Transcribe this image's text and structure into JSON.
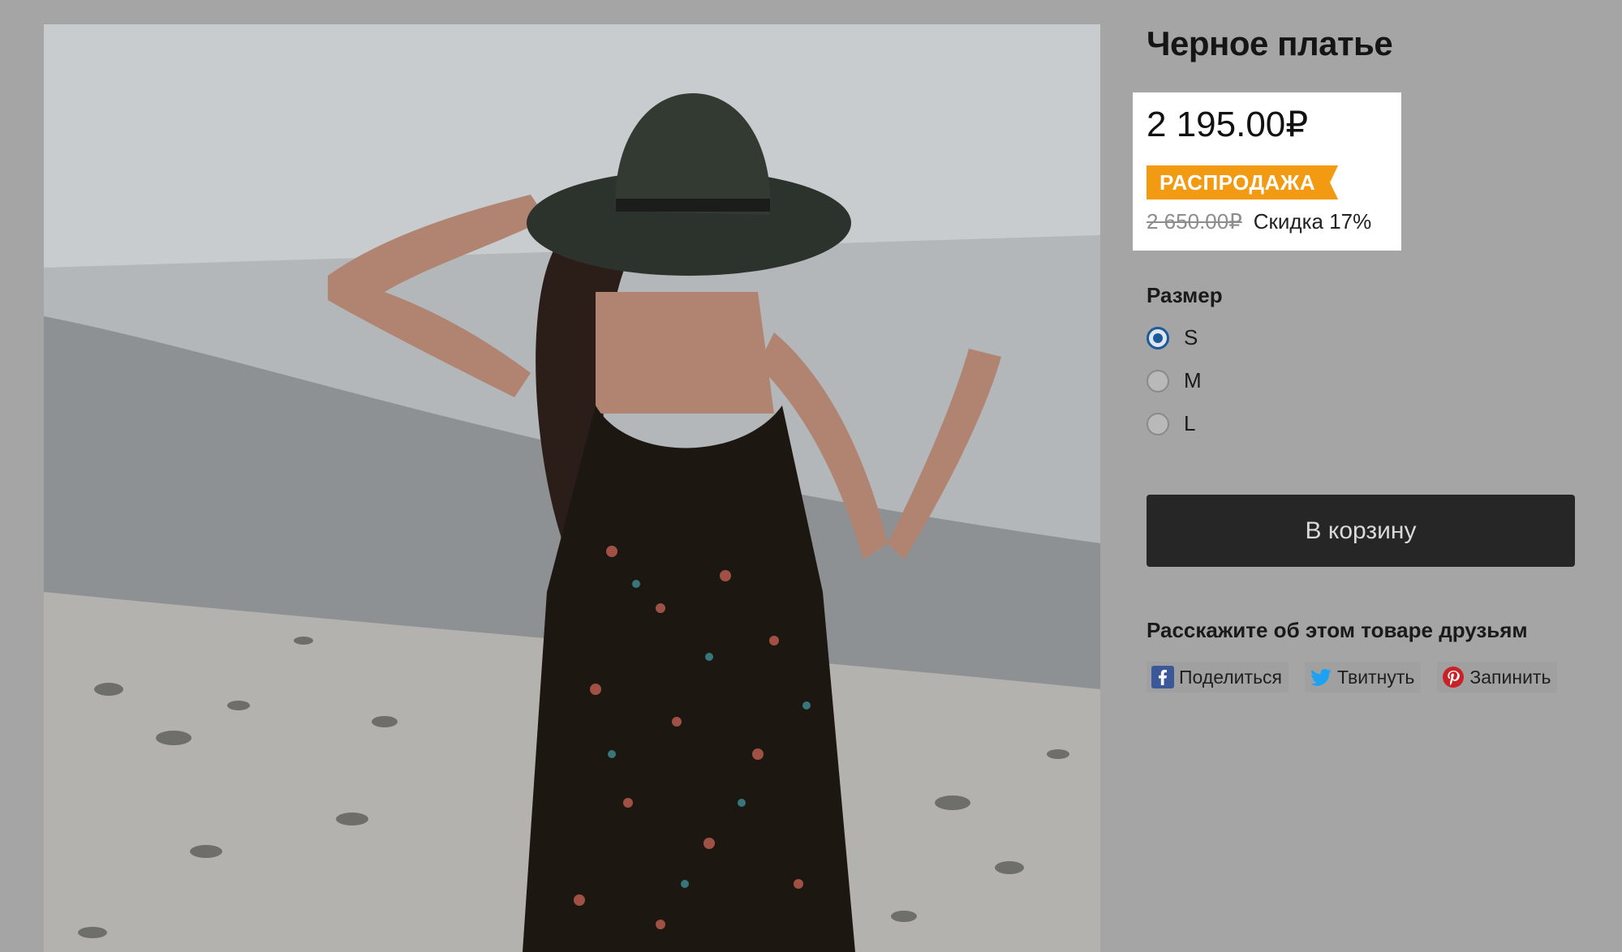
{
  "product": {
    "title": "Черное платье",
    "price": "2 195.00₽",
    "sale_badge": "РАСПРОДАЖА",
    "old_price": "2 650.00₽",
    "discount": "Скидка 17%",
    "photo_icon": "product-photo"
  },
  "size": {
    "label": "Размер",
    "options": [
      {
        "label": "S",
        "selected": true
      },
      {
        "label": "M",
        "selected": false
      },
      {
        "label": "L",
        "selected": false
      }
    ]
  },
  "cart": {
    "button_label": "В корзину"
  },
  "share": {
    "heading": "Расскажите об этом товаре друзьям",
    "buttons": [
      {
        "label": "Поделиться",
        "icon": "facebook-icon"
      },
      {
        "label": "Твитнуть",
        "icon": "twitter-icon"
      },
      {
        "label": "Запинить",
        "icon": "pinterest-icon"
      }
    ]
  },
  "colors": {
    "accent": "#f29a12",
    "button": "#262626",
    "radio": "#1d5a9a"
  }
}
